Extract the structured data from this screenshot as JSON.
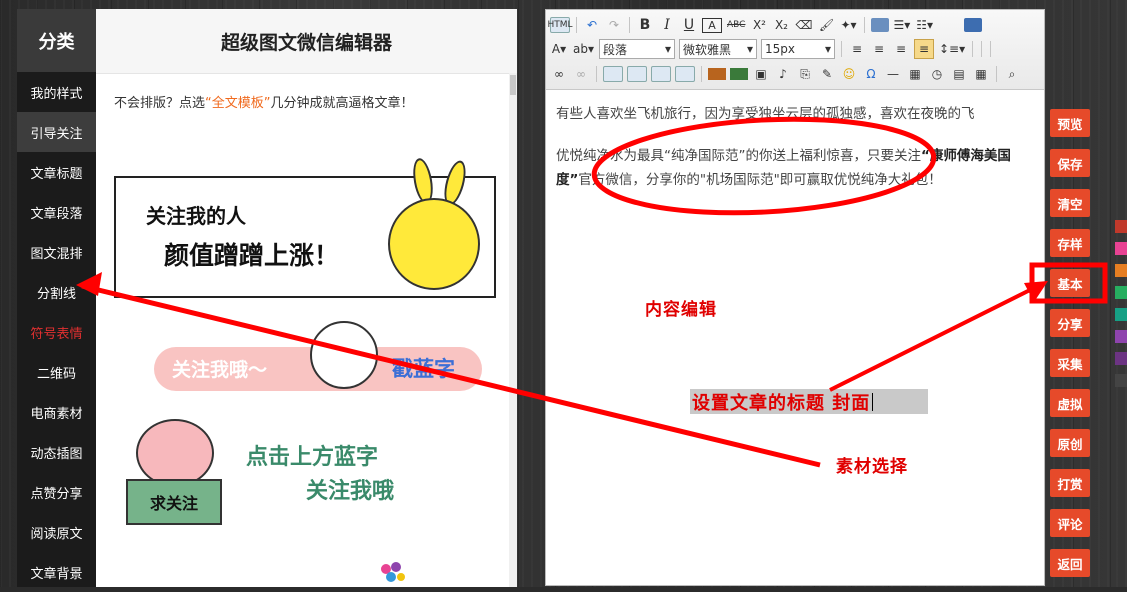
{
  "sidebar": {
    "heading": "分类",
    "items": [
      {
        "label": "我的样式",
        "state": "normal"
      },
      {
        "label": "引导关注",
        "state": "active"
      },
      {
        "label": "文章标题",
        "state": "normal"
      },
      {
        "label": "文章段落",
        "state": "normal"
      },
      {
        "label": "图文混排",
        "state": "normal"
      },
      {
        "label": "分割线",
        "state": "normal"
      },
      {
        "label": "符号表情",
        "state": "red"
      },
      {
        "label": "二维码",
        "state": "normal"
      },
      {
        "label": "电商素材",
        "state": "normal"
      },
      {
        "label": "动态插图",
        "state": "normal"
      },
      {
        "label": "点赞分享",
        "state": "normal"
      },
      {
        "label": "阅读原文",
        "state": "normal"
      },
      {
        "label": "文章背景",
        "state": "normal"
      }
    ]
  },
  "panel": {
    "title": "超级图文微信编辑器",
    "hint_prefix": "不会排版？点选",
    "hint_link": "“全文模板”",
    "hint_suffix": "几分钟成就高逼格文章！",
    "card1_line1": "关注我的人",
    "card1_line2": "颜值蹭蹭上涨！",
    "banner2_text1": "关注我哦～",
    "banner2_text2": "戳蓝字",
    "pig_sign": "求关注",
    "pig_text1": "点击上方蓝字",
    "pig_text2": "关注我哦"
  },
  "editor": {
    "toolbar": {
      "html_label": "HTML",
      "bold": "B",
      "italic": "I",
      "underline": "U",
      "font_color_label": "A",
      "strike": "ABC",
      "superscript": "X²",
      "subscript": "X₂",
      "paragraph_select": "段落",
      "font_select": "微软雅黑",
      "size_select": "15px",
      "omega": "Ω"
    },
    "content": {
      "line1": "有些人喜欢坐飞机旅行，因为享受独坐云层的孤独感，喜欢在夜晚的飞",
      "para2_a": "优悦纯净水为最具“纯净国际范”的你送上福利惊喜，只要关注",
      "para2_bold1": "“康师傅海美国度”",
      "para2_b": "官方微信，分享你的\"机场国际范\"即可赢取优悦纯净大礼包！"
    }
  },
  "annotations": {
    "content_edit": "内容编辑",
    "set_title": "设置文章的标题 封面",
    "material_select": "素材选择"
  },
  "right_buttons": [
    "预览",
    "保存",
    "清空",
    "存样",
    "基本",
    "分享",
    "采集",
    "虚拟",
    "原创",
    "打赏",
    "评论",
    "返回"
  ],
  "colors": {
    "accent_orange": "#e64a2a",
    "annotation_red": "#e00000",
    "swatches": [
      "#c0392b",
      "#e84393",
      "#e67e22",
      "#27ae60",
      "#16a085",
      "#8e44ad",
      "#6c3483",
      "#444444"
    ]
  }
}
